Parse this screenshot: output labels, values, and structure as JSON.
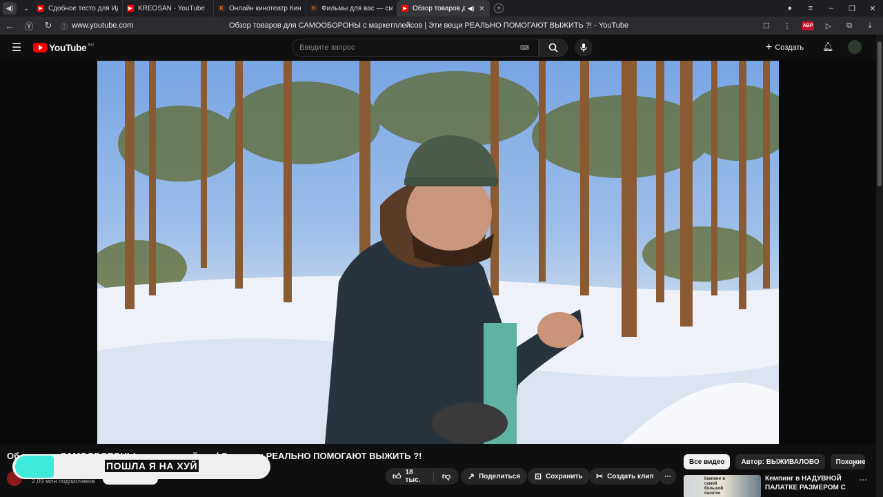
{
  "browser": {
    "tabs": [
      {
        "label": "Сдобное тесто для ИДЕАЛ",
        "favicon": "yt",
        "active": false
      },
      {
        "label": "KREOSAN - YouTube",
        "favicon": "yt",
        "active": false
      },
      {
        "label": "Онлайн кинотеатр Кинопо",
        "favicon": "kp",
        "active": false
      },
      {
        "label": "Фильмы для вас — смотрит",
        "favicon": "kp",
        "active": false
      },
      {
        "label": "Обзор товаров для",
        "favicon": "yt",
        "active": true
      }
    ],
    "url": "www.youtube.com",
    "page_title": "Обзор товаров для САМООБОРОНЫ с маркетплейсов | Эти вещи РЕАЛЬНО ПОМОГАЮТ ВЫЖИТЬ ?! - YouTube",
    "abp_label": "ABP"
  },
  "youtube": {
    "logo_text": "YouTube",
    "region": "RU",
    "search_placeholder": "Введите запрос",
    "create_label": "Создать"
  },
  "video": {
    "title": "Обзор товаров для САМООБОРОНЫ с маркетплейсов | Эти вещи РЕАЛЬНО ПОМОГАЮТ ВЫЖИТЬ ?!",
    "title_visible": "Об                 ров для САМООБОРОНЫ с маркетплейсов | Эти вещи РЕАЛЬНО ПОМОГАЮТ ВЫЖИТЬ ?!",
    "overlay_caption": "ПОШЛА Я НА ХУЙ",
    "subscribers": "2,09 млн подписчиков",
    "likes": "18 тыс.",
    "share_label": "Поделиться",
    "save_label": "Сохранить",
    "clip_label": "Создать клип"
  },
  "sidebar": {
    "chips": [
      "Все видео",
      "Автор: ВЫЖИВАЛОВО",
      "Похожие"
    ],
    "recommendation": {
      "title": "Кемпинг в НАДУВНОЙ ПАЛАТКЕ РАЗМЕРОМ С ...",
      "thumb_text": "Кемпинг в самой большой палатке"
    }
  },
  "colors": {
    "accent": "#ff0000",
    "overlay_teal": "#3fe9dc"
  }
}
